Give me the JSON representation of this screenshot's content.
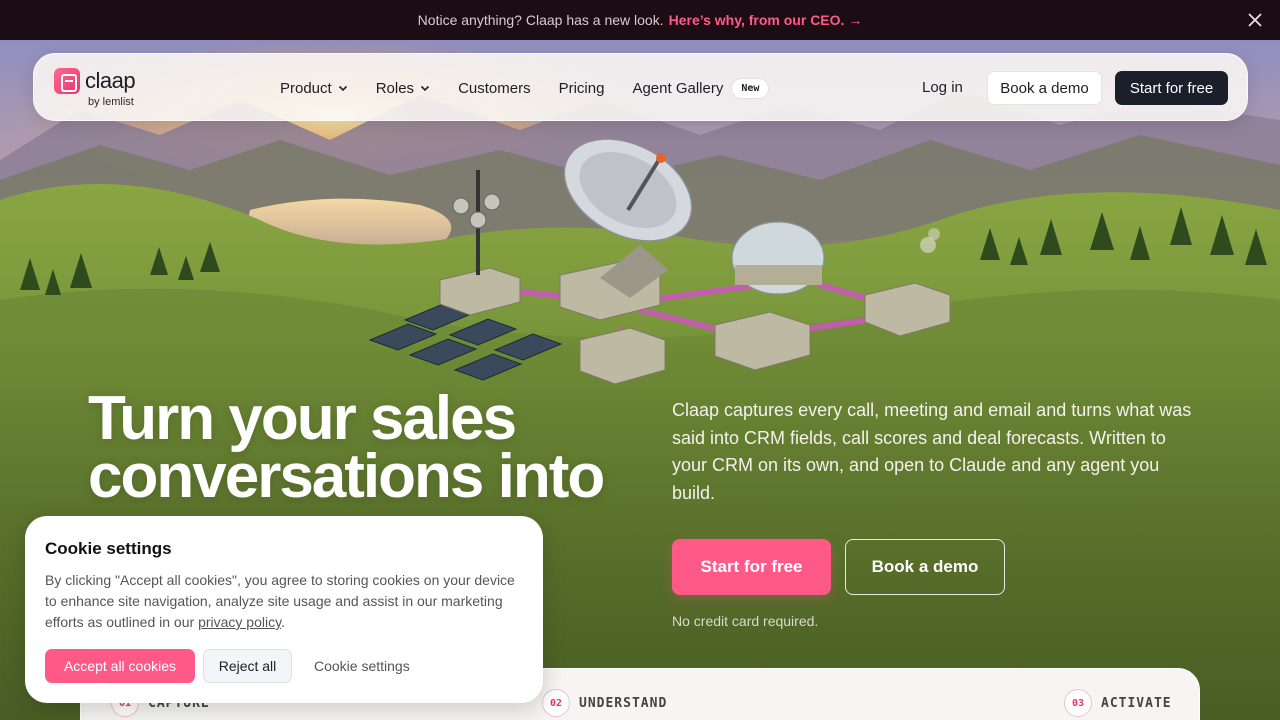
{
  "announcement": {
    "text": "Notice anything? Claap has a new look.",
    "link": "Here’s why, from our CEO. →"
  },
  "brand": {
    "name": "claap",
    "byline": "by lemlist",
    "accent": "#ff5a87",
    "dark": "#1b1f2c"
  },
  "nav": {
    "items": [
      {
        "label": "Product",
        "dropdown": true
      },
      {
        "label": "Roles",
        "dropdown": true
      },
      {
        "label": "Customers"
      },
      {
        "label": "Pricing"
      },
      {
        "label": "Agent Gallery",
        "badge": "New"
      }
    ],
    "login": "Log in",
    "book_demo": "Book a demo",
    "start_free": "Start for free"
  },
  "hero": {
    "headline_line1": "Turn your sales",
    "headline_line2": "conversations into",
    "subcopy": "Claap captures every call, meeting and email and turns what was said into CRM fields, call scores and deal forecasts. Written to your CRM on its own, and open to Claude and any agent you build.",
    "cta_primary": "Start for free",
    "cta_secondary": "Book a demo",
    "note": "No credit card required."
  },
  "steps": [
    {
      "num": "01",
      "label": "CAPTURE"
    },
    {
      "num": "02",
      "label": "UNDERSTAND"
    },
    {
      "num": "03",
      "label": "ACTIVATE"
    }
  ],
  "cookie": {
    "title": "Cookie settings",
    "text_before": "By clicking \"Accept all cookies\", you agree to storing cookies on your device to enhance site navigation, analyze site usage and assist in our marketing efforts as outlined in our ",
    "link": "privacy policy",
    "text_after": ".",
    "accept": "Accept all cookies",
    "reject": "Reject all",
    "settings": "Cookie settings"
  }
}
